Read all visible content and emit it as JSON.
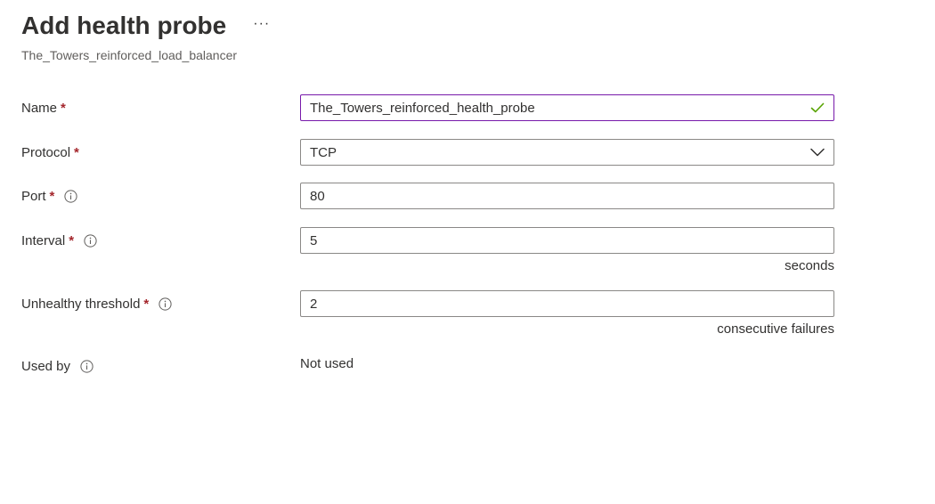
{
  "header": {
    "title": "Add health probe",
    "more_label": "···",
    "subtitle": "The_Towers_reinforced_load_balancer"
  },
  "form": {
    "name": {
      "label": "Name",
      "required": "*",
      "value": "The_Towers_reinforced_health_probe",
      "valid_icon": "checkmark-icon"
    },
    "protocol": {
      "label": "Protocol",
      "required": "*",
      "value": "TCP",
      "options": [
        "TCP"
      ]
    },
    "port": {
      "label": "Port",
      "required": "*",
      "value": "80"
    },
    "interval": {
      "label": "Interval",
      "required": "*",
      "value": "5",
      "unit": "seconds"
    },
    "unhealthy_threshold": {
      "label": "Unhealthy threshold",
      "required": "*",
      "value": "2",
      "unit": "consecutive failures"
    },
    "used_by": {
      "label": "Used by",
      "value": "Not used"
    }
  },
  "colors": {
    "focus_border": "#7719aa",
    "valid_check": "#57a300",
    "required_asterisk": "#a4262c",
    "border": "#8a8886",
    "text": "#323130"
  }
}
